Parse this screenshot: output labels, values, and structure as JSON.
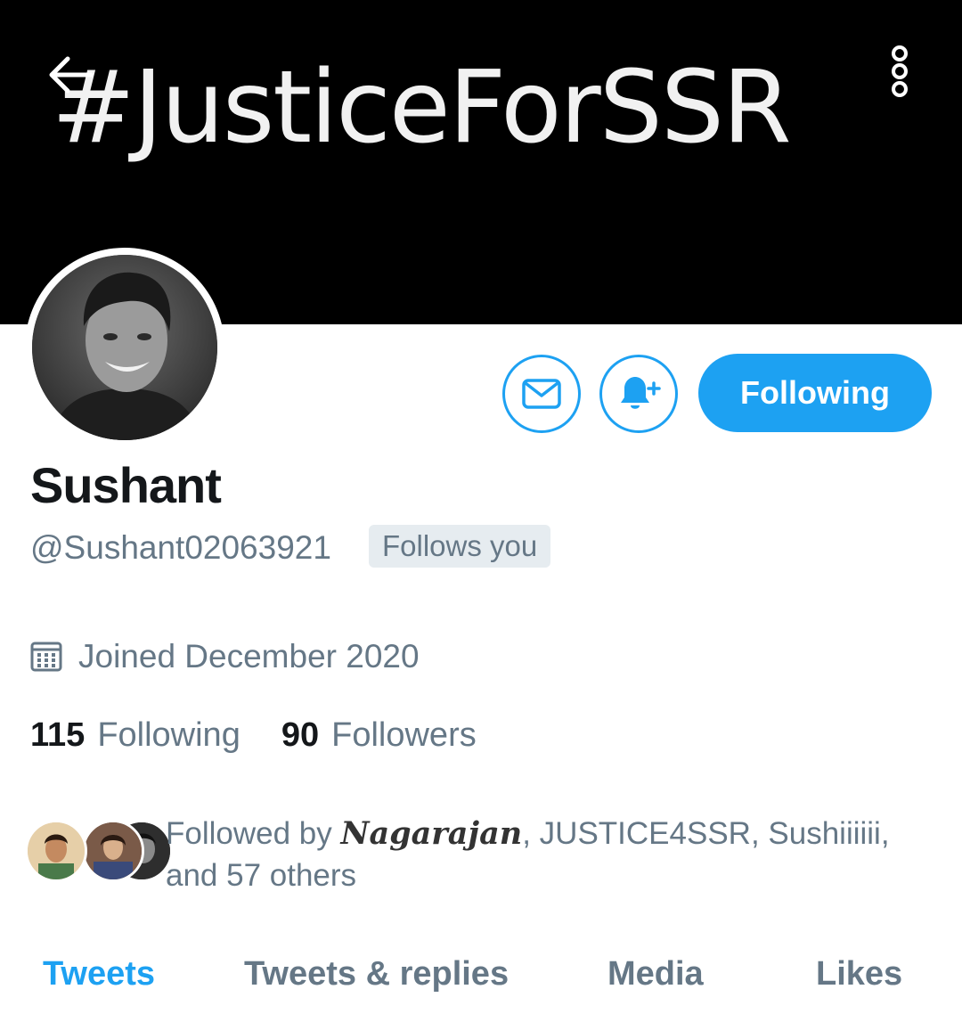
{
  "header": {
    "banner_text": "#JusticeForSSR",
    "back_icon": "arrow-left-icon",
    "more_icon": "more-vertical-icon"
  },
  "actions": {
    "message_icon": "envelope-icon",
    "notify_icon": "bell-plus-icon",
    "follow_label": "Following"
  },
  "profile": {
    "name": "Sushant",
    "handle": "@Sushant02063921",
    "follows_you": "Follows you",
    "joined_icon": "calendar-icon",
    "joined": "Joined December 2020"
  },
  "stats": {
    "following_count": "115",
    "following_label": "Following",
    "followers_count": "90",
    "followers_label": "Followers"
  },
  "followed_by": {
    "prefix": "Followed by ",
    "first_name": "Nagarajan",
    "rest": ", JUSTICE4SSR, Sushiiiiii, and 57 others"
  },
  "tabs": [
    "Tweets",
    "Tweets & replies",
    "Media",
    "Likes"
  ],
  "colors": {
    "accent": "#1da1f2",
    "secondary_text": "#657786",
    "primary_text": "#14171a",
    "banner_bg": "#000000"
  }
}
